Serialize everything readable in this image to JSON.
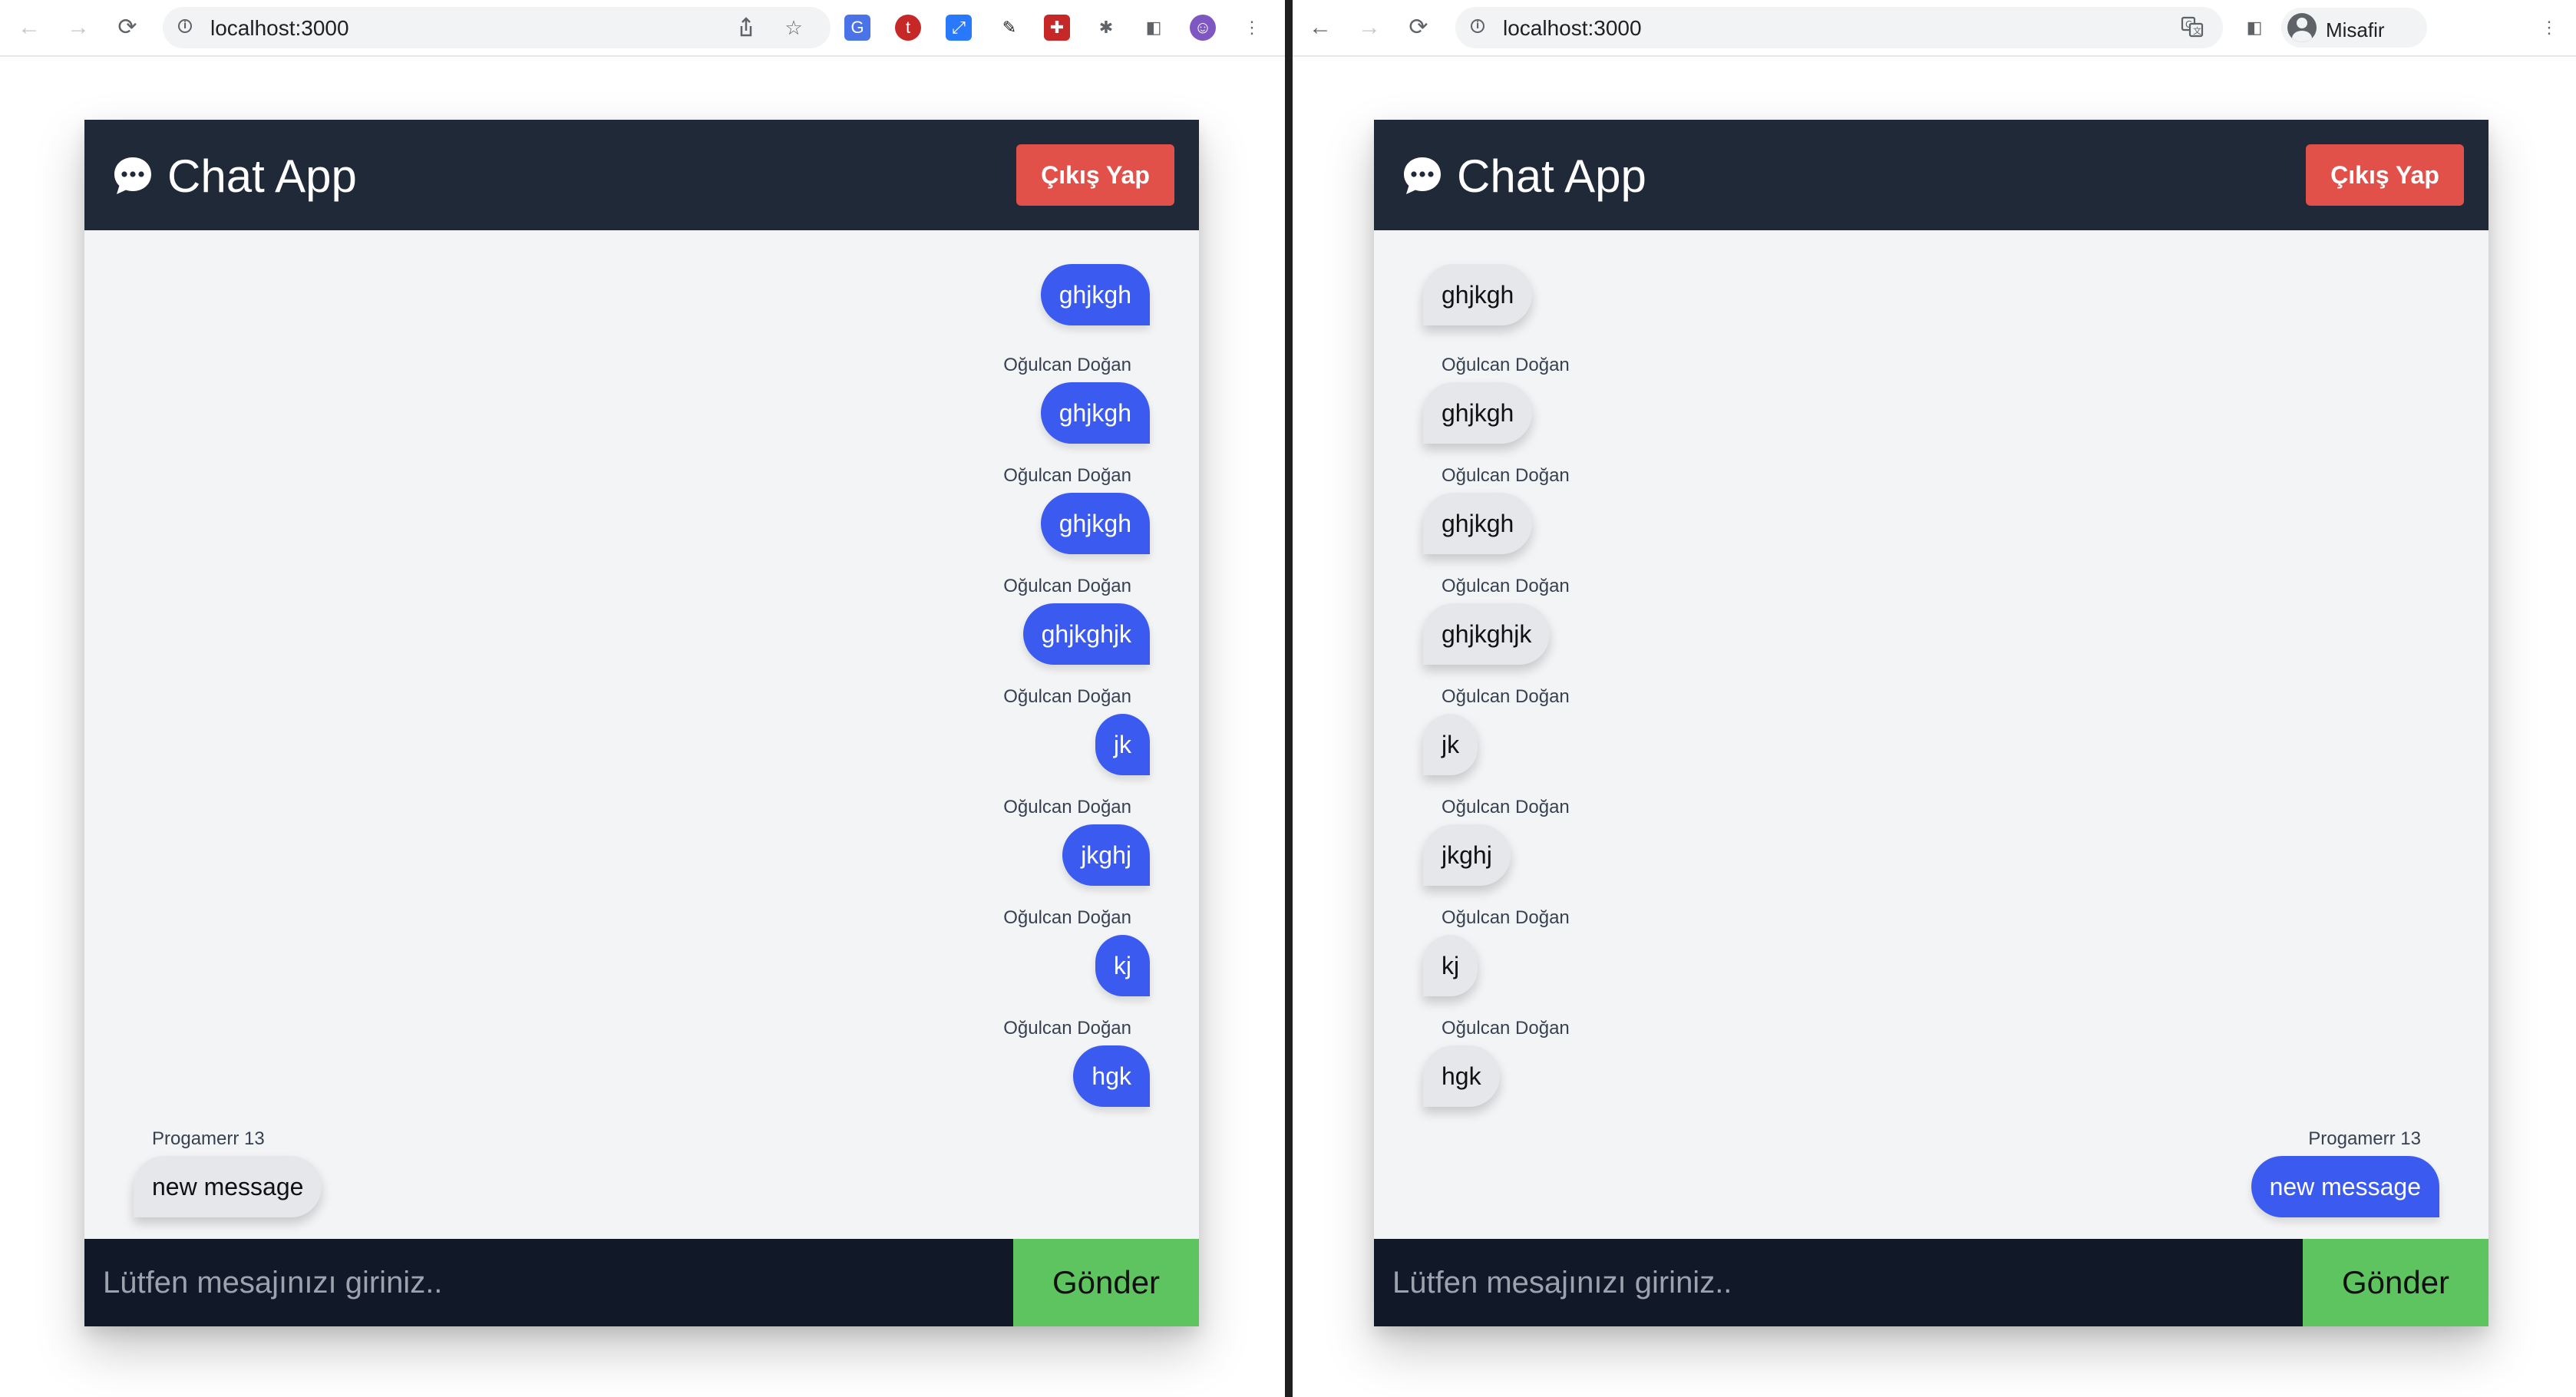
{
  "browser_left": {
    "url": "localhost:3000",
    "nav_icons": {
      "back": "←",
      "forward": "→",
      "reload": "⟳"
    },
    "omnibox_icons": [
      "share-icon",
      "bookmark-star-icon"
    ],
    "extensions": [
      "translate-extension-icon",
      "t-extension-icon",
      "resize-extension-icon",
      "color-picker-extension-icon",
      "game-extension-icon",
      "puzzle-extensions-icon",
      "side-panel-icon",
      "profile-avatar-icon",
      "kebab-menu-icon"
    ]
  },
  "browser_right": {
    "url": "localhost:3000",
    "profile_name": "Misafir",
    "nav_icons": {
      "back": "←",
      "forward": "→",
      "reload": "⟳"
    }
  },
  "app": {
    "title": "Chat App",
    "logout_label": "Çıkış Yap",
    "input_placeholder": "Lütfen mesajınızı giriniz..",
    "input_value": "",
    "send_label": "Gönder"
  },
  "messages_left": [
    {
      "author": "",
      "text": "ghjkgh",
      "side": "sent"
    },
    {
      "author": "Oğulcan Doğan",
      "text": "ghjkgh",
      "side": "sent"
    },
    {
      "author": "Oğulcan Doğan",
      "text": "ghjkgh",
      "side": "sent"
    },
    {
      "author": "Oğulcan Doğan",
      "text": "ghjkghjk",
      "side": "sent"
    },
    {
      "author": "Oğulcan Doğan",
      "text": "jk",
      "side": "sent"
    },
    {
      "author": "Oğulcan Doğan",
      "text": "jkghj",
      "side": "sent"
    },
    {
      "author": "Oğulcan Doğan",
      "text": "kj",
      "side": "sent"
    },
    {
      "author": "Oğulcan Doğan",
      "text": "hgk",
      "side": "sent"
    },
    {
      "author": "Progamerr 13",
      "text": "new message",
      "side": "received"
    }
  ],
  "messages_right": [
    {
      "author": "",
      "text": "ghjkgh",
      "side": "received"
    },
    {
      "author": "Oğulcan Doğan",
      "text": "ghjkgh",
      "side": "received"
    },
    {
      "author": "Oğulcan Doğan",
      "text": "ghjkgh",
      "side": "received"
    },
    {
      "author": "Oğulcan Doğan",
      "text": "ghjkghjk",
      "side": "received"
    },
    {
      "author": "Oğulcan Doğan",
      "text": "jk",
      "side": "received"
    },
    {
      "author": "Oğulcan Doğan",
      "text": "jkghj",
      "side": "received"
    },
    {
      "author": "Oğulcan Doğan",
      "text": "kj",
      "side": "received"
    },
    {
      "author": "Oğulcan Doğan",
      "text": "hgk",
      "side": "received"
    },
    {
      "author": "Progamerr 13",
      "text": "new message",
      "side": "sent"
    }
  ],
  "colors": {
    "header_bg": "#1f2937",
    "logout_red": "#e2504a",
    "sent_bubble": "#3b5bf0",
    "received_bubble": "#e5e7eb",
    "send_green": "#5dc45f",
    "composer_bg": "#111827",
    "chat_bg": "#f3f4f6"
  }
}
